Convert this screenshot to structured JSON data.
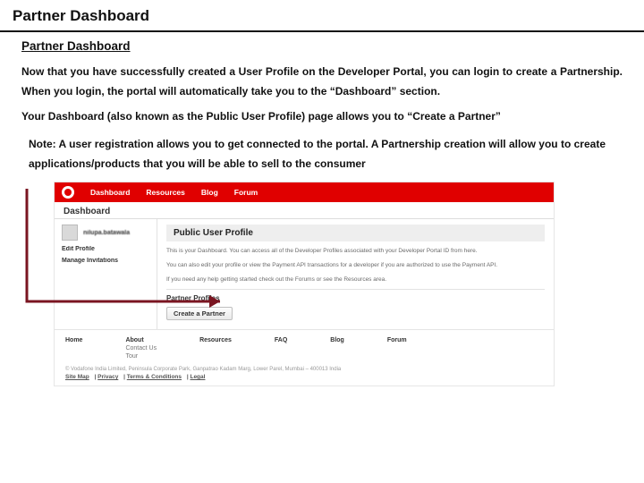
{
  "title": "Partner Dashboard",
  "subTitle": "Partner Dashboard",
  "para1": "Now that you have successfully created a User Profile on the Developer Portal, you can login to create a Partnership. When you login, the portal will automatically take you to the “Dashboard” section.",
  "para2": "Your Dashboard (also known as the Public User Profile) page allows you to “Create a Partner”",
  "note": "Note: A user registration allows you to get connected to the portal. A Partnership creation will allow you to create applications/products that you will be able to sell to the consumer",
  "portal": {
    "nav": [
      "Dashboard",
      "Resources",
      "Blog",
      "Forum"
    ],
    "dashLabel": "Dashboard",
    "username": "nilupa.batawala",
    "sideLinks": [
      "Edit Profile",
      "Manage Invitations"
    ],
    "panelHead": "Public User Profile",
    "p1": "This is your Dashboard. You can access all of the Developer Profiles associated with your Developer Portal ID from here.",
    "p2": "You can also edit your profile or view the Payment API transactions for a developer if you are authorized to use the Payment API.",
    "p3": "If you need any help getting started check out the Forums or see the Resources area.",
    "subH": "Partner Profiles",
    "createBtn": "Create a Partner",
    "footerCols": [
      {
        "h": "Home"
      },
      {
        "h": "About",
        "l1": "Contact Us",
        "l2": "Tour"
      },
      {
        "h": "Resources"
      },
      {
        "h": "FAQ"
      },
      {
        "h": "Blog"
      },
      {
        "h": "Forum"
      }
    ],
    "copyright": "© Vodafone India Limited, Peninsula Corporate Park, Ganpatrao Kadam Marg, Lower Parel, Mumbai – 400013 India",
    "legalLinks": [
      "Site Map",
      "Privacy",
      "Terms & Conditions",
      "Legal"
    ]
  }
}
